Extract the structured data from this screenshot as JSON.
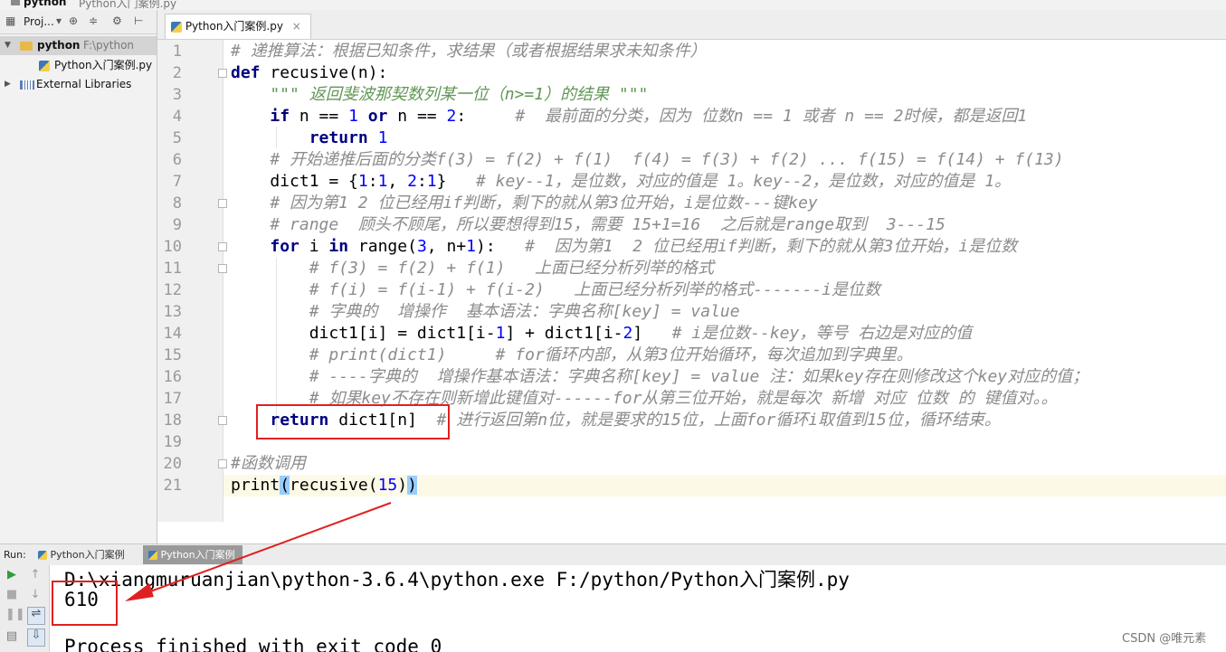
{
  "breadcrumb": {
    "project": "python",
    "file": "Python入门案例.py"
  },
  "project_panel": {
    "toolbar_label": "Proj...",
    "tree": [
      {
        "label": "python",
        "path": "F:\\python"
      },
      {
        "label": "Python入门案例.py"
      },
      {
        "label": "External Libraries"
      }
    ]
  },
  "editor": {
    "tab_label": "Python入门案例.py",
    "tab_close": "×",
    "line_numbers": [
      "1",
      "2",
      "3",
      "4",
      "5",
      "6",
      "7",
      "8",
      "9",
      "10",
      "11",
      "12",
      "13",
      "14",
      "15",
      "16",
      "17",
      "18",
      "19",
      "20",
      "21"
    ],
    "lines": [
      "# 递推算法：根据已知条件，求结果（或者根据结果求未知条件）",
      "def recusive(n):",
      "    \"\"\" 返回斐波那契数列某一位（n>=1）的结果 \"\"\"",
      "    if n == 1 or n == 2:     #  最前面的分类，因为 位数n == 1 或者 n == 2时候，都是返回1",
      "        return 1",
      "    # 开始递推后面的分类f(3) = f(2) + f(1)  f(4) = f(3) + f(2) ... f(15) = f(14) + f(13)",
      "    dict1 = {1:1, 2:1}   # key--1，是位数，对应的值是 1。key--2，是位数，对应的值是 1。",
      "    # 因为第1 2 位已经用if判断，剩下的就从第3位开始，i是位数---键key",
      "    # range  顾头不顾尾，所以要想得到15，需要 15+1=16  之后就是range取到  3---15",
      "    for i in range(3, n+1):   #  因为第1  2 位已经用if判断，剩下的就从第3位开始，i是位数",
      "        # f(3) = f(2) + f(1)   上面已经分析列举的格式",
      "        # f(i) = f(i-1) + f(i-2)   上面已经分析列举的格式-------i是位数",
      "        # 字典的  增操作  基本语法：字典名称[key] = value",
      "        dict1[i] = dict1[i-1] + dict1[i-2]   # i是位数--key，等号 右边是对应的值",
      "        # print(dict1)     # for循环内部，从第3位开始循环，每次追加到字典里。",
      "        # ----字典的  增操作基本语法：字典名称[key] = value 注：如果key存在则修改这个key对应的值；",
      "        # 如果key不存在则新增此键值对------for从第三位开始，就是每次 新增 对应 位数 的 键值对。。",
      "    return dict1[n]  # 进行返回第n位，就是要求的15位，上面for循环i取值到15位，循环结束。",
      "",
      "#函数调用",
      "print(recusive(15))"
    ]
  },
  "run": {
    "label": "Run:",
    "tabs": [
      "Python入门案例",
      "Python入门案例"
    ],
    "console": [
      "D:\\xiangmuruanjian\\python-3.6.4\\python.exe F:/python/Python入门案例.py",
      "610",
      "",
      "Process finished with exit code 0"
    ]
  },
  "watermark": "CSDN @唯元素",
  "colors": {
    "keyword": "#000080",
    "number": "#0000ff",
    "comment": "#8c8c8c",
    "docstring": "#629755",
    "annotation": "#e02020"
  }
}
